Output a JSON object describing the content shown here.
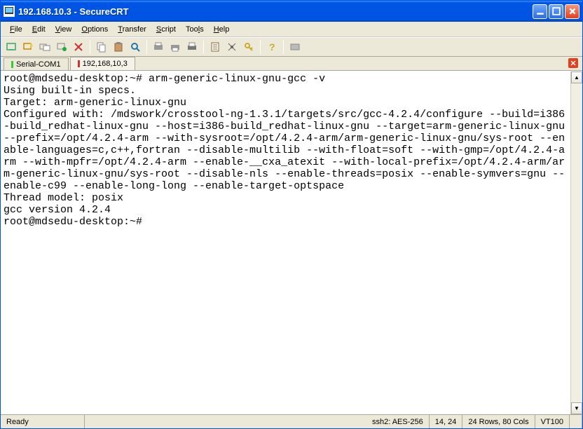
{
  "window": {
    "title": "192.168.10.3 - SecureCRT"
  },
  "menu": {
    "items": [
      {
        "pre": "",
        "ul": "F",
        "post": "ile"
      },
      {
        "pre": "",
        "ul": "E",
        "post": "dit"
      },
      {
        "pre": "",
        "ul": "V",
        "post": "iew"
      },
      {
        "pre": "",
        "ul": "O",
        "post": "ptions"
      },
      {
        "pre": "",
        "ul": "T",
        "post": "ransfer"
      },
      {
        "pre": "",
        "ul": "S",
        "post": "cript"
      },
      {
        "pre": "Too",
        "ul": "l",
        "post": "s"
      },
      {
        "pre": "",
        "ul": "H",
        "post": "elp"
      }
    ]
  },
  "tabs": {
    "items": [
      {
        "label": "Serial-COM1",
        "active": false,
        "indicator": "green"
      },
      {
        "label": "192,168,10,3",
        "active": true,
        "indicator": "red"
      }
    ]
  },
  "terminal": {
    "content": "root@mdsedu-desktop:~# arm-generic-linux-gnu-gcc -v\nUsing built-in specs.\nTarget: arm-generic-linux-gnu\nConfigured with: /mdswork/crosstool-ng-1.3.1/targets/src/gcc-4.2.4/configure --build=i386-build_redhat-linux-gnu --host=i386-build_redhat-linux-gnu --target=arm-generic-linux-gnu --prefix=/opt/4.2.4-arm --with-sysroot=/opt/4.2.4-arm/arm-generic-linux-gnu/sys-root --enable-languages=c,c++,fortran --disable-multilib --with-float=soft --with-gmp=/opt/4.2.4-arm --with-mpfr=/opt/4.2.4-arm --enable-__cxa_atexit --with-local-prefix=/opt/4.2.4-arm/arm-generic-linux-gnu/sys-root --disable-nls --enable-threads=posix --enable-symvers=gnu --enable-c99 --enable-long-long --enable-target-optspace\nThread model: posix\ngcc version 4.2.4\nroot@mdsedu-desktop:~# "
  },
  "status": {
    "ready": "Ready",
    "conn": "ssh2: AES-256",
    "cursor": "14,  24",
    "size": "24 Rows,  80 Cols",
    "term": "VT100"
  }
}
